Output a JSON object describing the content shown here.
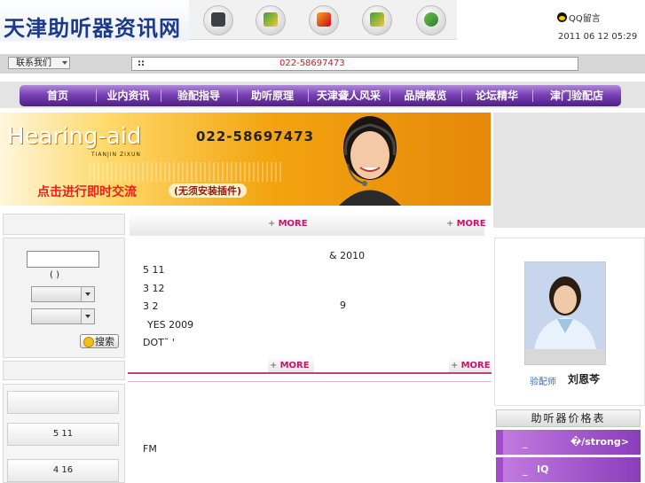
{
  "header": {
    "logo_text": "天津助听器资讯网",
    "qq_link": "QQ留言",
    "datetime": "2011 06 12 05:29",
    "icons": [
      "computer-icon",
      "pencil-icon",
      "book-icon",
      "pencil-icon",
      "people-icon"
    ]
  },
  "toolbar": {
    "contact_label": "联系我们",
    "notice_marker": "::",
    "notice_phone": "022-58697473"
  },
  "nav": {
    "items": [
      "首页",
      "业内资讯",
      "验配指导",
      "助听原理",
      "天津聋人风采",
      "品牌概览",
      "论坛精华",
      "津门验配店"
    ]
  },
  "banner": {
    "brand": "Hearing-aid",
    "brand_sub": "TIANJIN ZIXUN",
    "phone": "022-58697473",
    "cta": "点击进行即时交流",
    "cta_note": "(无须安装插件)"
  },
  "left": {
    "search_hint": "(      )",
    "search_button": "搜索",
    "list_items": [
      "",
      "5   11",
      "4   16"
    ]
  },
  "center": {
    "more_label": "MORE",
    "news_lines": [
      "&   2010",
      "5 11",
      "3 12",
      "3 2",
      "9",
      "YES 2009",
      "DOT˜ '",
      "FM"
    ]
  },
  "right": {
    "photo_role": "验配师",
    "photo_name": "刘恩芩",
    "price_title": "助听器价格表",
    "price_rows": [
      "_",
      "�/strong>",
      "_",
      "IQ"
    ]
  },
  "colors": {
    "nav_purple": "#7a41b5",
    "more_pink": "#cc1466",
    "notice_red": "#e0102a"
  }
}
